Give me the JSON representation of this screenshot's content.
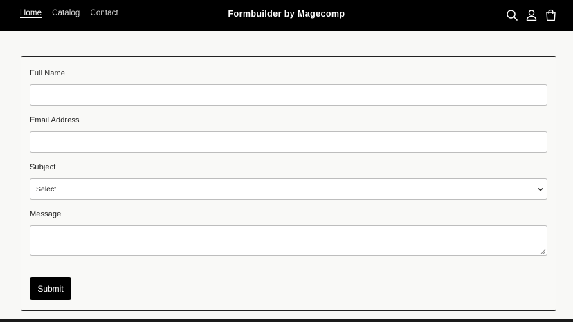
{
  "header": {
    "nav": [
      {
        "label": "Home",
        "active": true
      },
      {
        "label": "Catalog",
        "active": false
      },
      {
        "label": "Contact",
        "active": false
      }
    ],
    "brand": "Formbuilder by Magecomp",
    "icons": [
      "search-icon",
      "account-icon",
      "cart-icon"
    ]
  },
  "form": {
    "full_name": {
      "label": "Full Name",
      "value": ""
    },
    "email": {
      "label": "Email Address",
      "value": ""
    },
    "subject": {
      "label": "Subject",
      "selected": "Select"
    },
    "message": {
      "label": "Message",
      "value": ""
    },
    "submit_label": "Submit"
  },
  "colors": {
    "header_bg": "#000000",
    "page_bg": "#f8f8f6",
    "button_bg": "#000000"
  }
}
